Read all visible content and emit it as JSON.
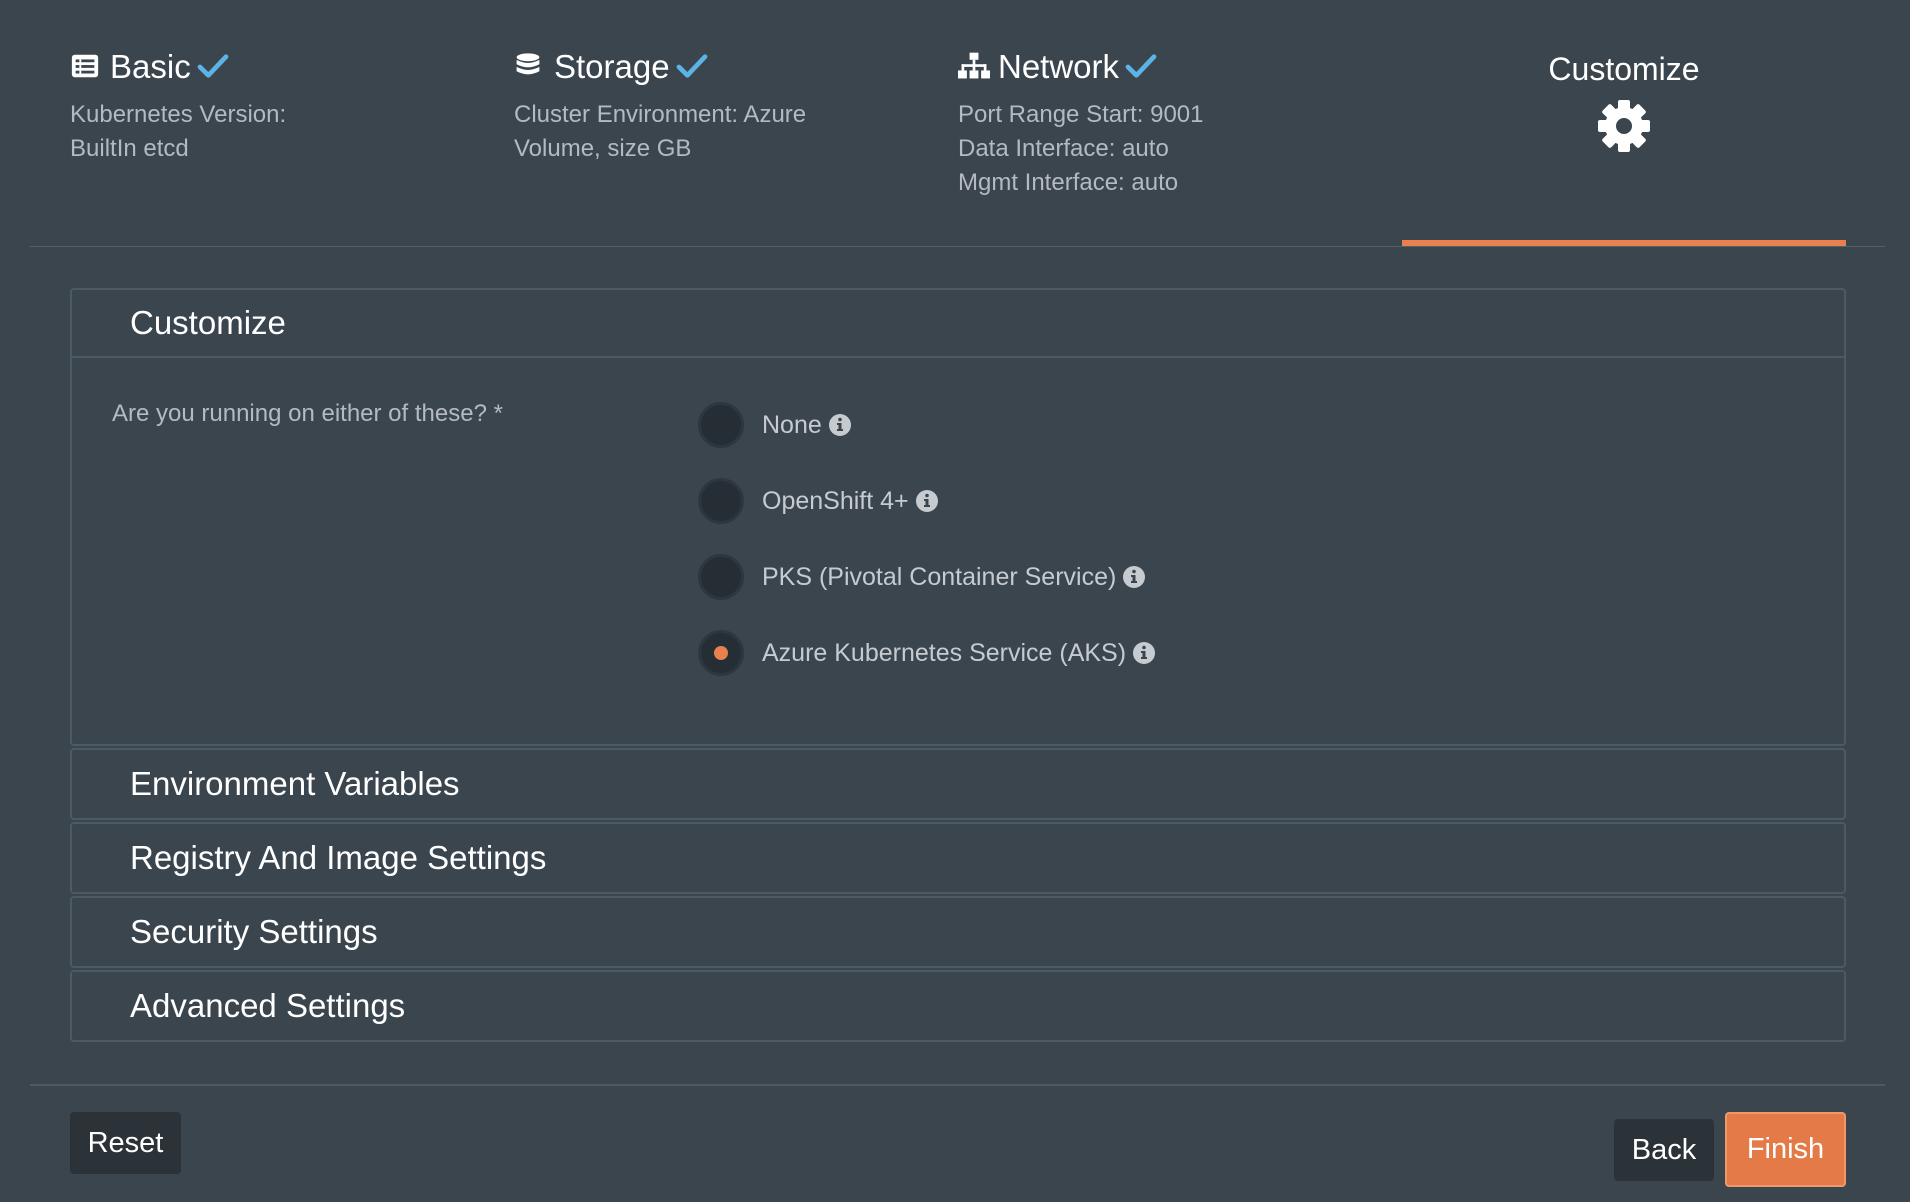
{
  "steps": [
    {
      "title": "Basic",
      "icon": "list-icon",
      "details": [
        "Kubernetes Version:",
        "BuiltIn etcd"
      ]
    },
    {
      "title": "Storage",
      "icon": "database-icon",
      "details": [
        "Cluster Environment: Azure",
        "Volume, size GB"
      ]
    },
    {
      "title": "Network",
      "icon": "sitemap-icon",
      "details": [
        "Port Range Start: 9001",
        "Data Interface: auto",
        "Mgmt Interface: auto"
      ]
    }
  ],
  "active_step": {
    "title": "Customize",
    "icon": "gear-icon"
  },
  "customize": {
    "title": "Customize",
    "question": "Are you running on either of these? *",
    "options": [
      {
        "label": "None",
        "selected": false
      },
      {
        "label": "OpenShift 4+",
        "selected": false
      },
      {
        "label": "PKS (Pivotal Container Service)",
        "selected": false
      },
      {
        "label": "Azure Kubernetes Service (AKS)",
        "selected": true
      }
    ]
  },
  "sections": [
    "Environment Variables",
    "Registry And Image Settings",
    "Security Settings",
    "Advanced Settings"
  ],
  "buttons": {
    "reset": "Reset",
    "back": "Back",
    "finish": "Finish"
  },
  "colors": {
    "accent": "#e8814f",
    "check": "#5bb4e5",
    "background": "#3a454e"
  }
}
